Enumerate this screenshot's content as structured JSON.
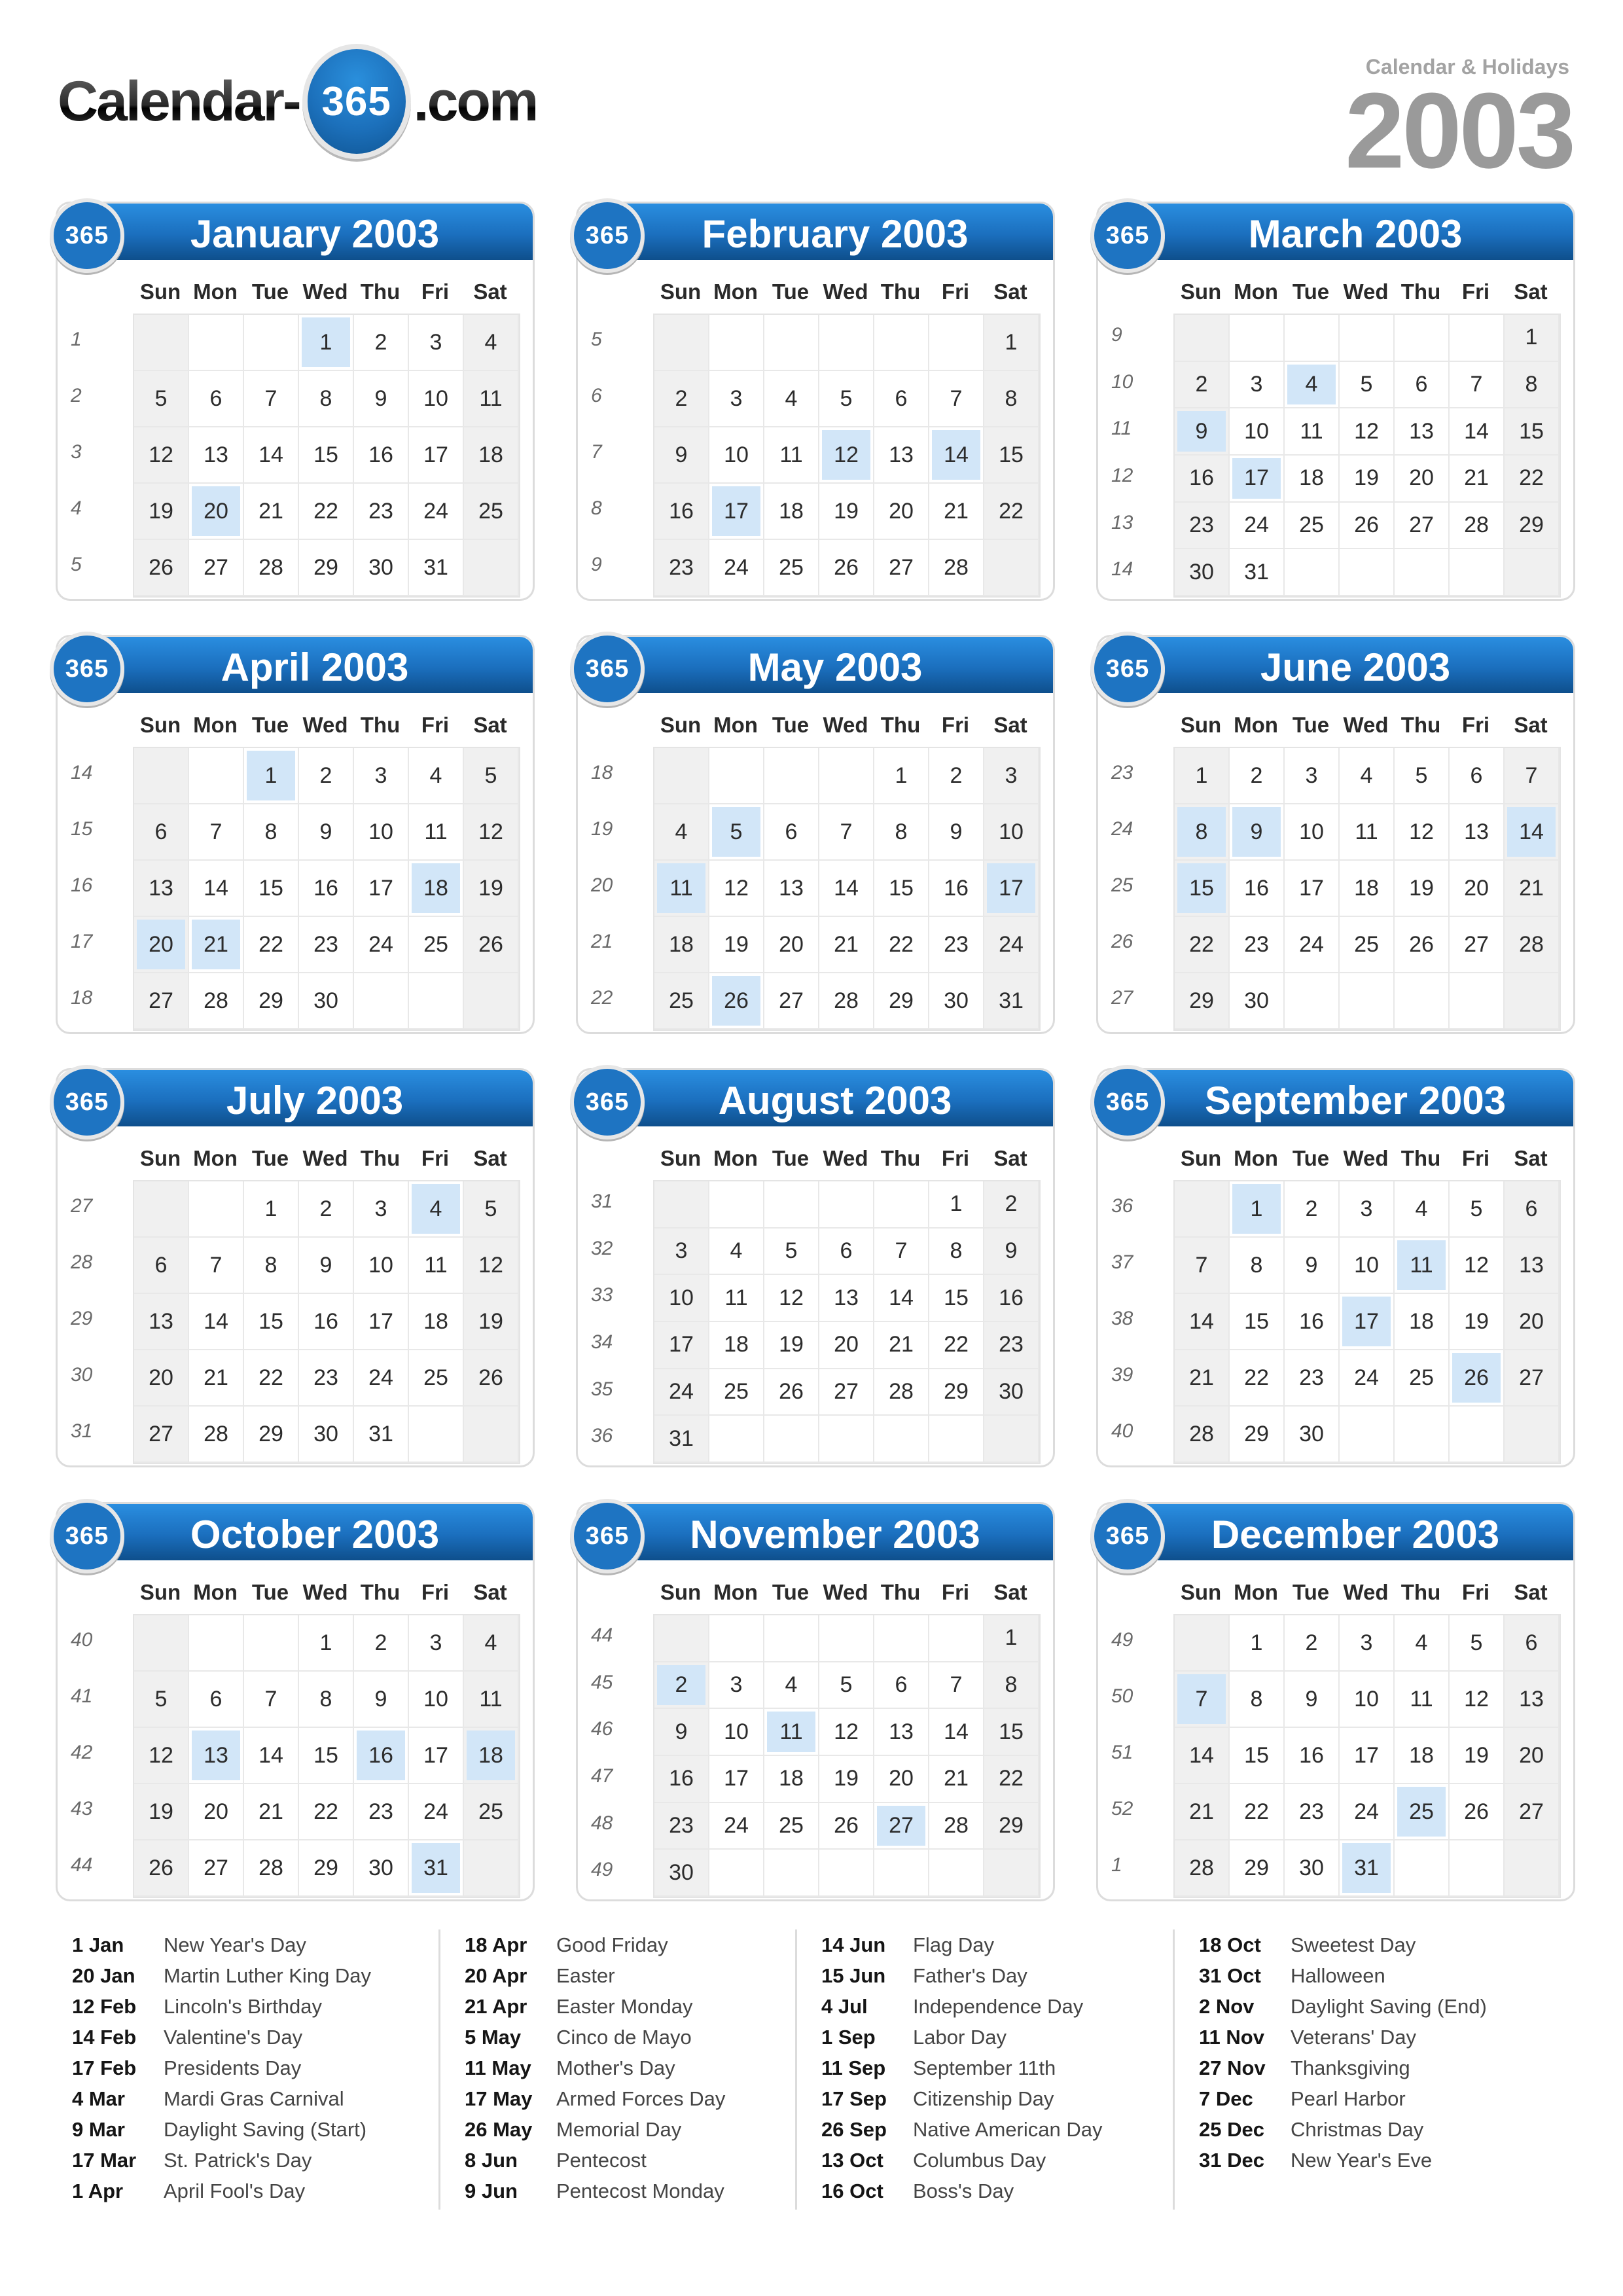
{
  "brand": {
    "logo_left": "Calendar-",
    "logo_badge": "365",
    "logo_right": ".com",
    "subtitle": "Calendar & Holidays",
    "year": "2003"
  },
  "badge_label": "365",
  "weekday_headers": [
    "Sun",
    "Mon",
    "Tue",
    "Wed",
    "Thu",
    "Fri",
    "Sat"
  ],
  "colors": {
    "header_blue": "#1b6fbe",
    "holiday_highlight": "#d2e6f8",
    "weekend_fill": "#f0f0f0",
    "year_gray": "#9a9a9a"
  },
  "months": [
    {
      "title": "January 2003",
      "first_weekday": 3,
      "days": 31,
      "weeks": [
        "1",
        "2",
        "3",
        "4",
        "5"
      ],
      "holidays": [
        1,
        20
      ]
    },
    {
      "title": "February 2003",
      "first_weekday": 6,
      "days": 28,
      "weeks": [
        "5",
        "6",
        "7",
        "8",
        "9"
      ],
      "holidays": [
        12,
        14,
        17
      ]
    },
    {
      "title": "March 2003",
      "first_weekday": 6,
      "days": 31,
      "weeks": [
        "9",
        "10",
        "11",
        "12",
        "13",
        "14"
      ],
      "holidays": [
        4,
        9,
        17
      ]
    },
    {
      "title": "April 2003",
      "first_weekday": 2,
      "days": 30,
      "weeks": [
        "14",
        "15",
        "16",
        "17",
        "18"
      ],
      "holidays": [
        1,
        18,
        20,
        21
      ]
    },
    {
      "title": "May 2003",
      "first_weekday": 4,
      "days": 31,
      "weeks": [
        "18",
        "19",
        "20",
        "21",
        "22"
      ],
      "holidays": [
        5,
        11,
        17,
        26
      ]
    },
    {
      "title": "June 2003",
      "first_weekday": 0,
      "days": 30,
      "weeks": [
        "23",
        "24",
        "25",
        "26",
        "27"
      ],
      "holidays": [
        8,
        9,
        14,
        15
      ]
    },
    {
      "title": "July 2003",
      "first_weekday": 2,
      "days": 31,
      "weeks": [
        "27",
        "28",
        "29",
        "30",
        "31"
      ],
      "holidays": [
        4
      ]
    },
    {
      "title": "August 2003",
      "first_weekday": 5,
      "days": 31,
      "weeks": [
        "31",
        "32",
        "33",
        "34",
        "35",
        "36"
      ],
      "holidays": []
    },
    {
      "title": "September 2003",
      "first_weekday": 1,
      "days": 30,
      "weeks": [
        "36",
        "37",
        "38",
        "39",
        "40"
      ],
      "holidays": [
        1,
        11,
        17,
        26
      ]
    },
    {
      "title": "October 2003",
      "first_weekday": 3,
      "days": 31,
      "weeks": [
        "40",
        "41",
        "42",
        "43",
        "44"
      ],
      "holidays": [
        13,
        16,
        18,
        31
      ]
    },
    {
      "title": "November 2003",
      "first_weekday": 6,
      "days": 30,
      "weeks": [
        "44",
        "45",
        "46",
        "47",
        "48",
        "49"
      ],
      "holidays": [
        2,
        11,
        27
      ]
    },
    {
      "title": "December 2003",
      "first_weekday": 1,
      "days": 31,
      "weeks": [
        "49",
        "50",
        "51",
        "52",
        "1"
      ],
      "holidays": [
        7,
        25,
        31
      ]
    }
  ],
  "holiday_list": [
    [
      {
        "date": "1 Jan",
        "name": "New Year's Day"
      },
      {
        "date": "20 Jan",
        "name": "Martin Luther King Day"
      },
      {
        "date": "12 Feb",
        "name": "Lincoln's Birthday"
      },
      {
        "date": "14 Feb",
        "name": "Valentine's Day"
      },
      {
        "date": "17 Feb",
        "name": "Presidents Day"
      },
      {
        "date": "4 Mar",
        "name": "Mardi Gras Carnival"
      },
      {
        "date": "9 Mar",
        "name": "Daylight Saving (Start)"
      },
      {
        "date": "17 Mar",
        "name": "St. Patrick's Day"
      },
      {
        "date": "1 Apr",
        "name": "April Fool's Day"
      }
    ],
    [
      {
        "date": "18 Apr",
        "name": "Good Friday"
      },
      {
        "date": "20 Apr",
        "name": "Easter"
      },
      {
        "date": "21 Apr",
        "name": "Easter Monday"
      },
      {
        "date": "5 May",
        "name": "Cinco de Mayo"
      },
      {
        "date": "11 May",
        "name": "Mother's Day"
      },
      {
        "date": "17 May",
        "name": "Armed Forces Day"
      },
      {
        "date": "26 May",
        "name": "Memorial Day"
      },
      {
        "date": "8 Jun",
        "name": "Pentecost"
      },
      {
        "date": "9 Jun",
        "name": "Pentecost Monday"
      }
    ],
    [
      {
        "date": "14 Jun",
        "name": "Flag Day"
      },
      {
        "date": "15 Jun",
        "name": "Father's Day"
      },
      {
        "date": "4 Jul",
        "name": "Independence Day"
      },
      {
        "date": "1 Sep",
        "name": "Labor Day"
      },
      {
        "date": "11 Sep",
        "name": "September 11th"
      },
      {
        "date": "17 Sep",
        "name": "Citizenship Day"
      },
      {
        "date": "26 Sep",
        "name": "Native American Day"
      },
      {
        "date": "13 Oct",
        "name": "Columbus Day"
      },
      {
        "date": "16 Oct",
        "name": "Boss's Day"
      }
    ],
    [
      {
        "date": "18 Oct",
        "name": "Sweetest Day"
      },
      {
        "date": "31 Oct",
        "name": "Halloween"
      },
      {
        "date": "2 Nov",
        "name": "Daylight Saving (End)"
      },
      {
        "date": "11 Nov",
        "name": "Veterans' Day"
      },
      {
        "date": "27 Nov",
        "name": "Thanksgiving"
      },
      {
        "date": "7 Dec",
        "name": "Pearl Harbor"
      },
      {
        "date": "25 Dec",
        "name": "Christmas Day"
      },
      {
        "date": "31 Dec",
        "name": "New Year's Eve"
      }
    ]
  ]
}
